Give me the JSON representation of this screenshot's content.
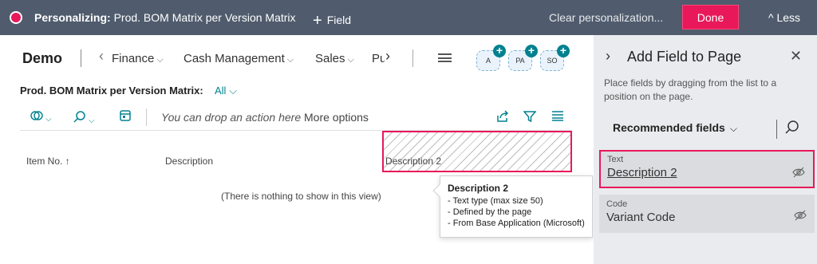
{
  "topbar": {
    "title_prefix": "Personalizing:",
    "title_page": "Prod. BOM Matrix per Version Matrix",
    "field_label": "Field",
    "clear_label": "Clear personalization...",
    "done_label": "Done",
    "less_label": "Less"
  },
  "nav": {
    "company": "Demo",
    "items": [
      "Finance",
      "Cash Management",
      "Sales",
      "Pu"
    ],
    "roles": [
      "A",
      "PA",
      "SO"
    ]
  },
  "page": {
    "header": "Prod. BOM Matrix per Version Matrix:",
    "filter": "All",
    "drop_action": "You can drop an action here",
    "more_options": "More options",
    "columns": [
      "Item No. ↑",
      "Description",
      "Description 2"
    ],
    "empty_text": "(There is nothing to show in this view)"
  },
  "tooltip": {
    "title": "Description 2",
    "lines": [
      "- Text type (max size 50)",
      "- Defined by the page",
      "- From Base Application (Microsoft)"
    ]
  },
  "panel": {
    "title": "Add Field to Page",
    "description": "Place fields by dragging from the list to a position on the page.",
    "section_label": "Recommended fields",
    "fields": [
      {
        "label": "Text",
        "value": "Description 2"
      },
      {
        "label": "Code",
        "value": "Variant Code"
      }
    ]
  },
  "colors": {
    "accent": "#00818f",
    "highlight": "#e8185a",
    "topbar": "#505c6d"
  },
  "icons": [
    "record-dot-icon",
    "plus-icon",
    "chevron-up-icon",
    "chevron-left-icon",
    "chevron-right-icon",
    "menu-icon",
    "filter-icon",
    "search-icon",
    "share-icon",
    "list-icon",
    "close-icon",
    "eye-off-icon"
  ]
}
